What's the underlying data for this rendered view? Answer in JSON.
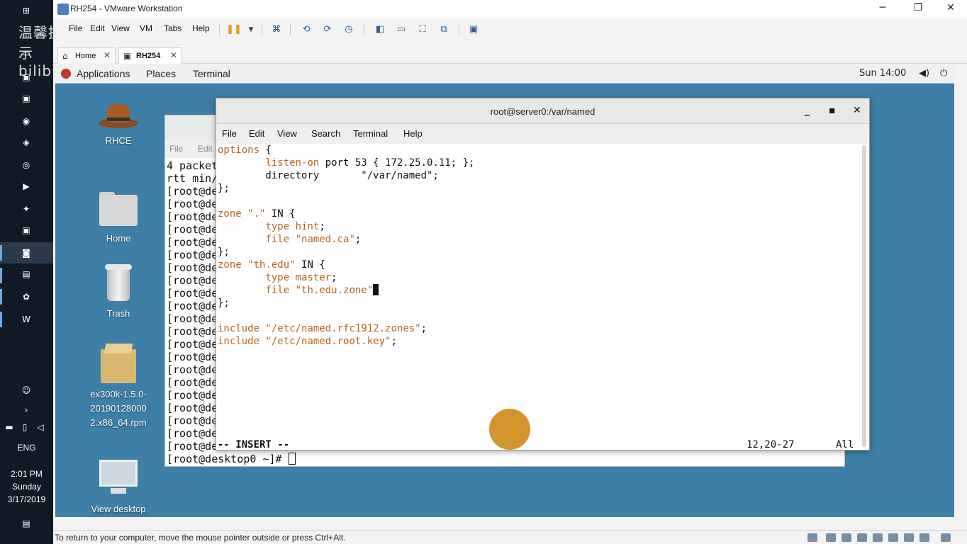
{
  "taskbar": {
    "watermark": "温馨提示 bilibili",
    "language": "ENG",
    "clock_time": "2:01 PM",
    "clock_day": "Sunday",
    "clock_date": "3/17/2019"
  },
  "window": {
    "title": "RH254 - VMware Workstation",
    "minimize": "─",
    "maximize": "❐",
    "close": "✕"
  },
  "menu": {
    "file": "File",
    "edit": "Edit",
    "view": "View",
    "vm": "VM",
    "tabs": "Tabs",
    "help": "Help"
  },
  "tabs": [
    {
      "label": "Home",
      "close": "✕"
    },
    {
      "label": "RH254",
      "close": "✕"
    }
  ],
  "gnome": {
    "applications": "Applications",
    "places": "Places",
    "terminal": "Terminal",
    "clock": "Sun 14:00"
  },
  "desktop": {
    "icons": [
      {
        "label": "RHCE"
      },
      {
        "label": "Home"
      },
      {
        "label": "Trash"
      },
      {
        "label_lines": [
          "ex300k-1.5.0-",
          "20190128000",
          "2.x86_64.rpm"
        ]
      },
      {
        "label": "View desktop"
      }
    ]
  },
  "bg_terminal": {
    "menu": [
      "File",
      "Edit"
    ],
    "lines": [
      "4 packet",
      "rtt min/",
      "[root@de",
      "[root@de",
      "[root@de",
      "[root@de",
      "[root@de",
      "[root@de",
      "[root@de",
      "[root@de",
      "[root@de",
      "[root@de",
      "[root@de",
      "[root@de",
      "[root@de",
      "[root@de",
      "[root@de",
      "[root@de",
      "[root@de",
      "[root@de",
      "[root@de",
      "[root@de",
      "[root@de"
    ],
    "prompt": "[root@desktop0 ~]# "
  },
  "fg_terminal": {
    "title": "root@server0:/var/named",
    "controls": {
      "minimize": "_",
      "maximize": "▪",
      "close": "✕"
    },
    "menu": [
      "File",
      "Edit",
      "View",
      "Search",
      "Terminal",
      "Help"
    ],
    "status_mode": "-- INSERT --",
    "status_pos": "12,20-27",
    "status_all": "All"
  },
  "statusbar": {
    "hint": "To return to your computer, move the mouse pointer outside or press Ctrl+Alt."
  }
}
